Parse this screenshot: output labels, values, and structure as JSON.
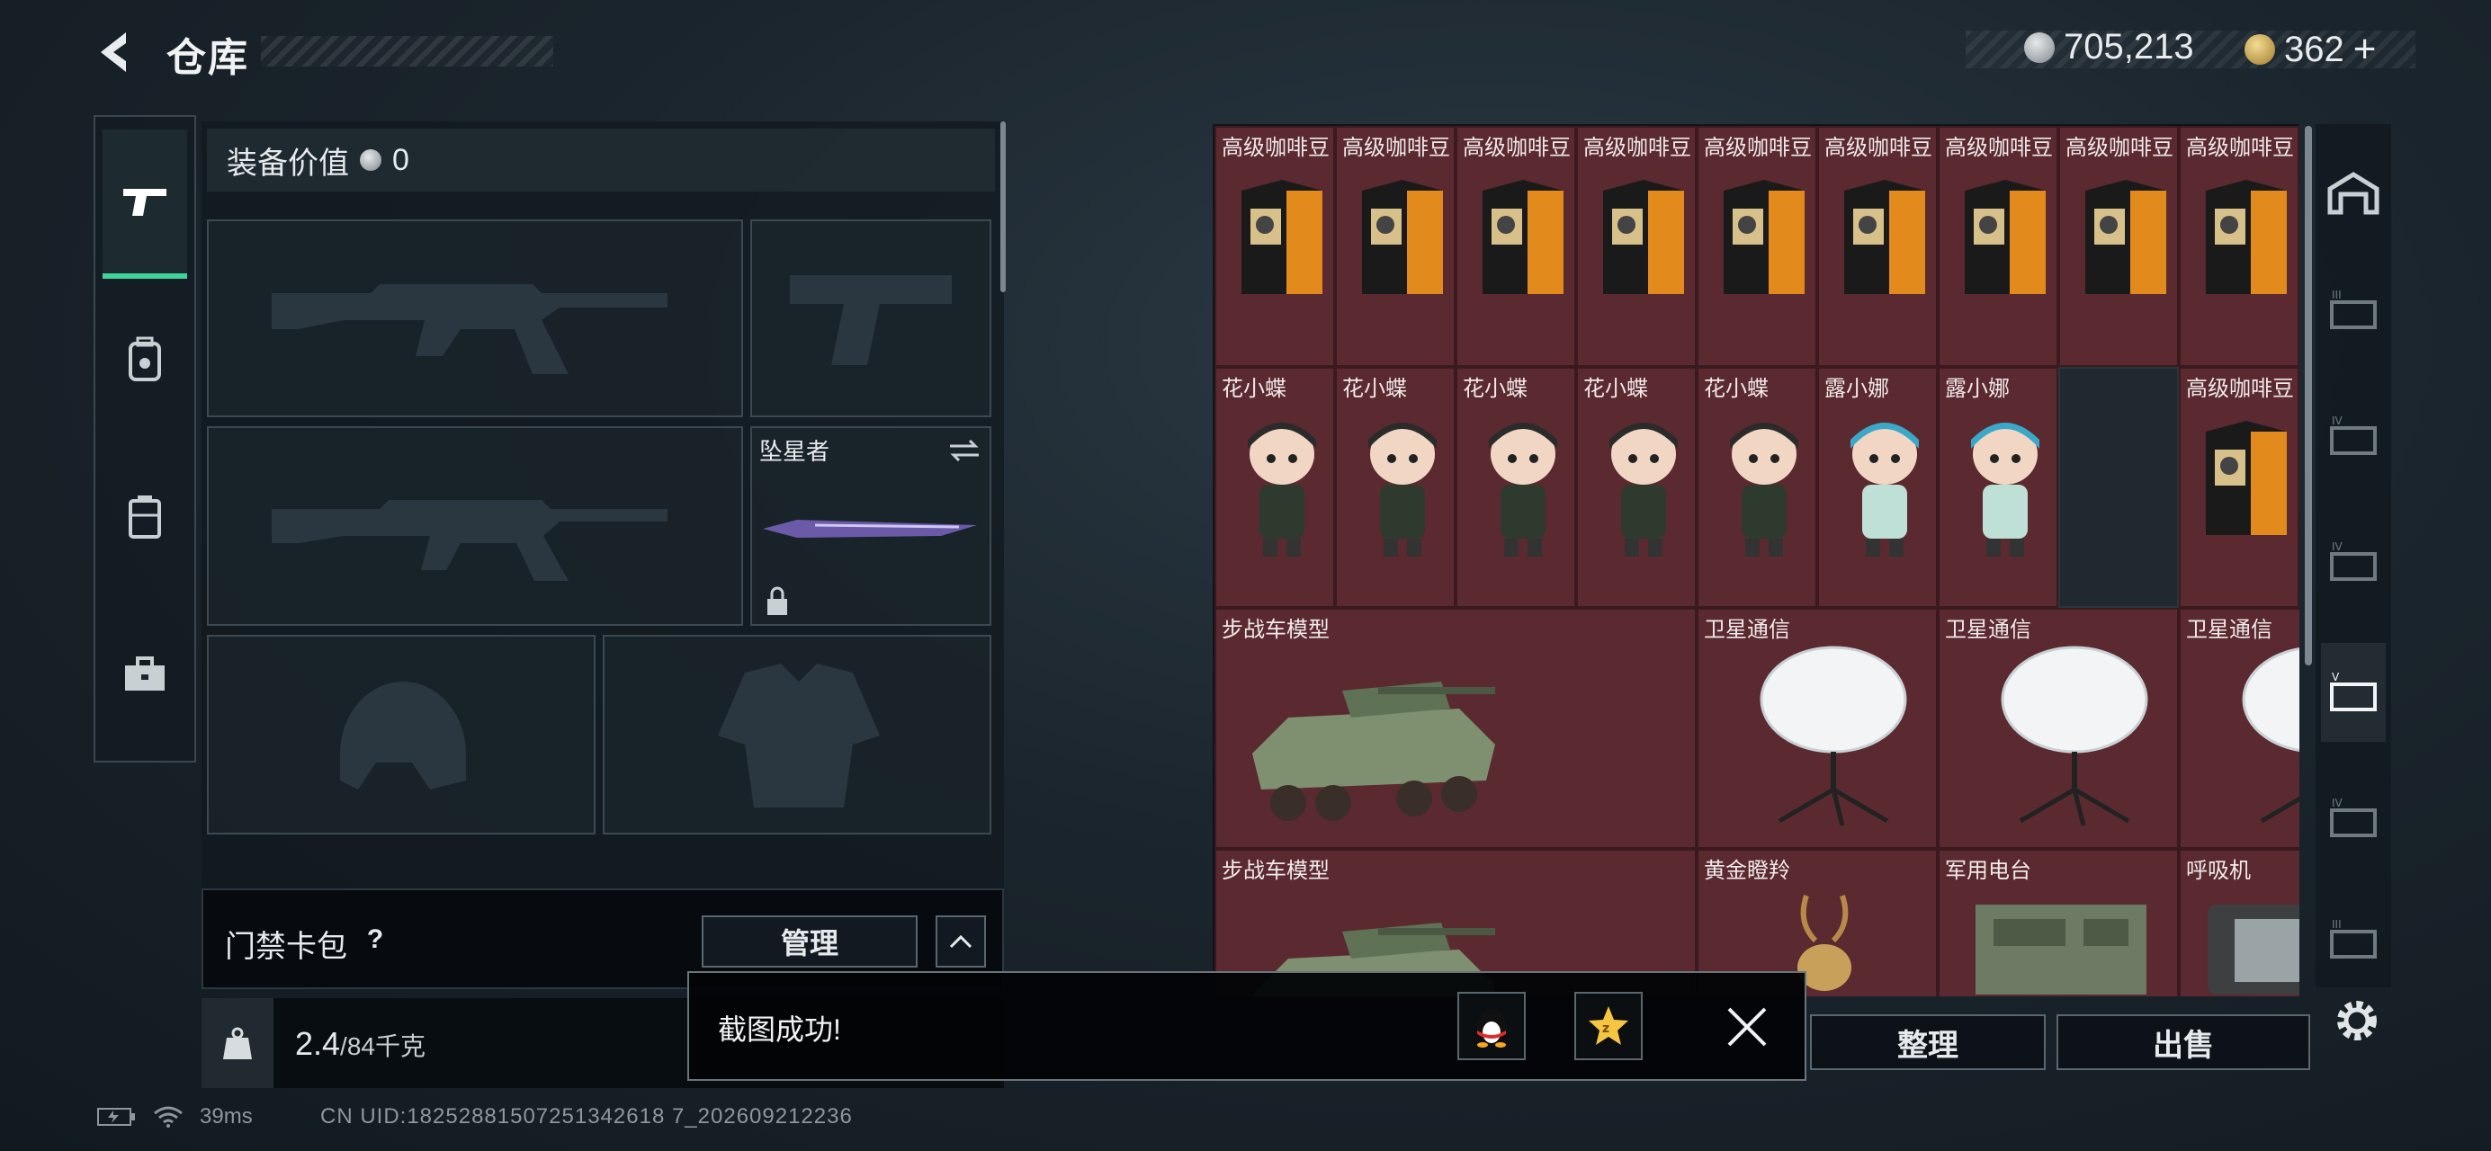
{
  "header": {
    "title": "仓库"
  },
  "currency": {
    "silver": "705,213",
    "gold": "362",
    "gold_plus": "+"
  },
  "left_rail": {
    "items": [
      "pistol-icon",
      "backpack-icon",
      "chest-rig-icon",
      "toolbox-icon"
    ],
    "active": 0
  },
  "loadout": {
    "value_label": "装备价值",
    "value": "0",
    "melee_label": "坠星者"
  },
  "access_card": {
    "label": "门禁卡包",
    "help": "?",
    "manage": "管理"
  },
  "weight": {
    "current": "2.4",
    "max": "/84千克"
  },
  "grid": {
    "row1": [
      "高级咖啡豆",
      "高级咖啡豆",
      "高级咖啡豆",
      "高级咖啡豆",
      "高级咖啡豆",
      "高级咖啡豆",
      "高级咖啡豆",
      "高级咖啡豆",
      "高级咖啡豆"
    ],
    "row2": [
      "花小蝶",
      "花小蝶",
      "花小蝶",
      "花小蝶",
      "花小蝶",
      "露小娜",
      "露小娜",
      "",
      "高级咖啡豆"
    ],
    "row3": [
      "步战车模型",
      "卫星通信",
      "卫星通信",
      "卫星通信"
    ],
    "row4": [
      "步战车模型",
      "黄金瞪羚",
      "军用电台",
      "呼吸机"
    ]
  },
  "actions": {
    "sort": "整理",
    "sell": "出售"
  },
  "toast": {
    "message": "截图成功!"
  },
  "status": {
    "ping": "39ms",
    "uid": "CN UID:18252881507251342618 7_202609212236"
  },
  "colors": {
    "accent": "#3fd39a",
    "cell": "#5a2a30",
    "gold": "#d7b45a"
  }
}
